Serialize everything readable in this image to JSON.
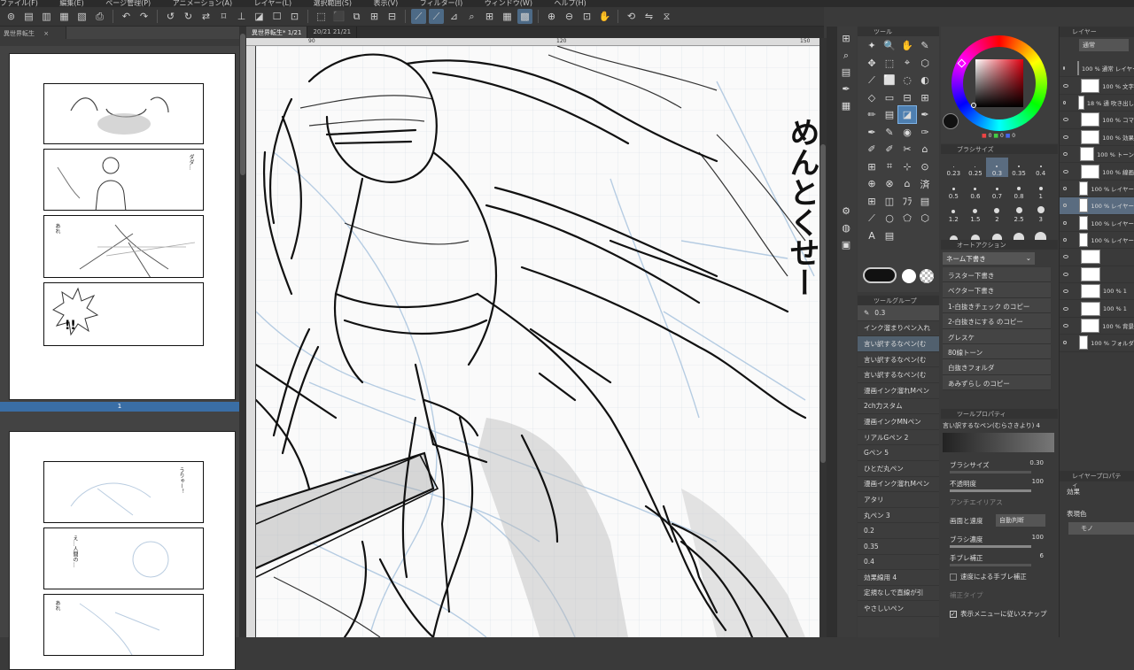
{
  "menubar": [
    "ファイル(F)",
    "編集(E)",
    "ページ管理(P)",
    "アニメーション(A)",
    "レイヤー(L)",
    "選択範囲(S)",
    "表示(V)",
    "フィルター(I)",
    "ウィンドウ(W)",
    "ヘルプ(H)"
  ],
  "pages_panel": {
    "tab_label": "異世界転生",
    "page1_number": "1",
    "page1_texts": [
      "ダダ…",
      "あれ"
    ],
    "page1_bang": "!!",
    "page2_texts": [
      "うりゃー！",
      "え…人間の…",
      "あれ"
    ]
  },
  "canvas": {
    "tabs": [
      "異世界転生* 1/21",
      "20/21 21/21"
    ],
    "ruler_marks": [
      "90",
      "120",
      "150"
    ],
    "vertical_text": "めんとくせー"
  },
  "tool_panel": {
    "title": "ツール",
    "tools": [
      "✦",
      "🔍",
      "✋",
      "✎",
      "✥",
      "⬚",
      "⌖",
      "⬡",
      "⟋",
      "⬜",
      "◌",
      "◐",
      "◇",
      "▭",
      "⊟",
      "⊞",
      "✏",
      "▤",
      "◪",
      "✒",
      "✒",
      "✎",
      "◉",
      "✑",
      "✐",
      "✐",
      "✂",
      "⌂",
      "⊞",
      "⌗",
      "⊹",
      "⊙",
      "⊕",
      "⊗",
      "⌂",
      "済",
      "⊞",
      "◫",
      "ﾌﾗ",
      "▤",
      "⟋",
      "○",
      "⬠",
      "⬡",
      "A",
      "▤",
      "",
      ""
    ],
    "selected_index": 18
  },
  "subtool": {
    "title": "ツールグループ",
    "size_display": "0.3",
    "items": [
      "インク溜まりペン入れ",
      "言い訳するなペン(む",
      "言い訳するなペン(む",
      "言い訳するなペン(む",
      "漫画インク溜れMペン",
      "2ch力スタム",
      "漫画インクMNペン",
      "リアルGペン 2",
      "Gペン 5",
      "ひとだ丸ペン",
      "漫画インク溜れMペン",
      "アタリ",
      "丸ペン 3",
      "0.2",
      "0.35",
      "0.4",
      "効果線用 4",
      "定規なしで直線が引",
      "やさしいペン"
    ],
    "selected_index": 1
  },
  "color": {
    "rgb_labels": [
      "0",
      "0",
      "0"
    ]
  },
  "brush_size": {
    "title": "ブラシサイズ",
    "sizes": [
      "0.23",
      "0.25",
      "0.3",
      "0.35",
      "0.4",
      "0.5",
      "0.6",
      "0.7",
      "0.8",
      "1",
      "1.2",
      "1.5",
      "2",
      "2.5",
      "3",
      "",
      "",
      "",
      "",
      ""
    ],
    "selected_index": 2
  },
  "auto_action": {
    "title": "オートアクション",
    "set_name": "ネーム下書き",
    "items": [
      "ラスター下書き",
      "ベクター下書き",
      "1-白抜きチェック のコピー",
      "2-白抜きにする のコピー",
      "グレスケ",
      "80線トーン",
      "白抜きフォルダ",
      "あみずらし のコピー"
    ]
  },
  "tool_property": {
    "title": "ツールプロパティ",
    "tool_name": "言い訳するなペン(むらさきより) 4",
    "brush_size_label": "ブラシサイズ",
    "brush_size_value": "0.30",
    "opacity_label": "不透明度",
    "opacity_value": "100",
    "antialias_label": "アンチエイリアス",
    "merge_label": "画面と速度",
    "merge_value": "自動判断",
    "brush_density_label": "ブラシ濃度",
    "brush_density_value": "100",
    "stabilize_label": "手ブレ補正",
    "stabilize_value": "6",
    "speed_stabilize_label": "速度による手ブレ補正",
    "correction_type_label": "補正タイプ",
    "snap_label": "表示メニューに従いスナップ"
  },
  "layer_panel": {
    "title": "レイヤー",
    "blend_mode": "通常",
    "rows": [
      {
        "text": "100 % 通常 レイヤー"
      },
      {
        "text": "100 % 文字"
      },
      {
        "text": "18 % 通 吹き出し"
      },
      {
        "text": "100 % コマ"
      },
      {
        "text": "100 % 効果"
      },
      {
        "text": "100 % トーン"
      },
      {
        "text": "100 % 線画"
      },
      {
        "text": "100 % レイヤー"
      },
      {
        "text": "100 % レイヤー"
      },
      {
        "text": "100 % レイヤー"
      },
      {
        "text": "100 % レイヤー"
      },
      {
        "text": ""
      },
      {
        "text": ""
      },
      {
        "text": "100 % 1"
      },
      {
        "text": "100 % 1"
      },
      {
        "text": "100 % 背景"
      },
      {
        "text": "100 % フォルダ"
      }
    ],
    "selected_index": 8
  },
  "layer_property": {
    "title": "レイヤープロパティ",
    "effect_label": "効果",
    "display_color_label": "表現色",
    "display_color_value": "モノ"
  }
}
